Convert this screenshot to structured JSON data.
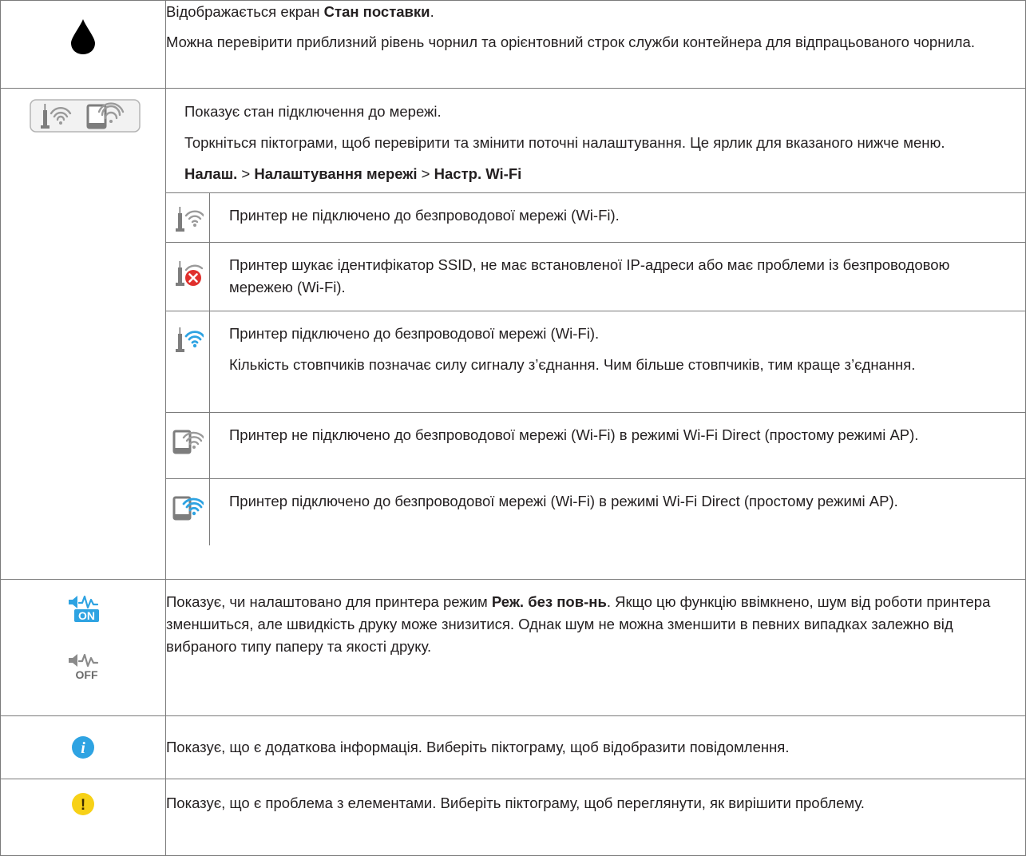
{
  "rows": {
    "ink": {
      "icon": "ink-drop-icon",
      "line1_pre": "Відображається екран ",
      "line1_bold": "Стан поставки",
      "line1_post": ".",
      "line2": "Можна перевірити приблизний рівень чорнил та орієнтовний строк служби контейнера для відпрацьованого чорнила."
    },
    "network": {
      "icon": "network-status-icon",
      "line1": "Показує стан підключення до мережі.",
      "line2": "Торкніться піктограми, щоб перевірити та змінити поточні налаштування. Це ярлик для вказаного нижче меню.",
      "path": {
        "part1": "Налаш.",
        "sep1": " > ",
        "part2": "Налаштування мережі",
        "sep2": " > ",
        "part3": "Настр. Wi-Fi"
      },
      "sub": [
        {
          "icon": "wifi-disconnected-icon",
          "text": "Принтер не підключено до безпроводової мережі (Wi-Fi)."
        },
        {
          "icon": "wifi-error-icon",
          "text": "Принтер шукає ідентифікатор SSID, не має встановленої IP-адреси або має проблеми із безпроводовою мережею (Wi-Fi)."
        },
        {
          "icon": "wifi-connected-icon",
          "text": "Принтер підключено до безпроводової мережі (Wi-Fi).",
          "text2": "Кількість стовпчиків позначає силу сигналу з’єднання. Чим більше стовпчиків, тим краще з’єднання."
        },
        {
          "icon": "wifi-direct-disconnected-icon",
          "text": "Принтер не підключено до безпроводової мережі (Wi-Fi) в режимі Wi-Fi Direct (простому режимі AP)."
        },
        {
          "icon": "wifi-direct-connected-icon",
          "text": "Принтер підключено до безпроводової мережі (Wi-Fi) в режимі Wi-Fi Direct (простому режимі AP)."
        }
      ]
    },
    "quiet": {
      "icon_on": "quiet-mode-on-icon",
      "icon_off": "quiet-mode-off-icon",
      "icon_on_label": "ON",
      "icon_off_label": "OFF",
      "text_pre": "Показує, чи налаштовано для принтера режим ",
      "text_bold": "Реж. без пов-нь",
      "text_post": ". Якщо цю функцію ввімкнено, шум від роботи принтера зменшиться, але швидкість друку може знизитися. Однак шум не можна зменшити в певних випадках залежно від вибраного типу паперу та якості друку."
    },
    "info": {
      "icon": "info-icon",
      "glyph": "i",
      "text": "Показує, що є додаткова інформація. Виберіть піктограму, щоб відобразити повідомлення."
    },
    "warning": {
      "icon": "warning-icon",
      "glyph": "!",
      "text": "Показує, що є проблема з елементами. Виберіть піктограму, щоб переглянути, як вирішити проблему."
    }
  },
  "colors": {
    "border": "#7a7a7a",
    "text": "#231f20",
    "accent_blue": "#2ea3e2",
    "warning_yellow": "#f7d117",
    "error_red": "#e0302d",
    "icon_gray": "#8a8a8a"
  }
}
